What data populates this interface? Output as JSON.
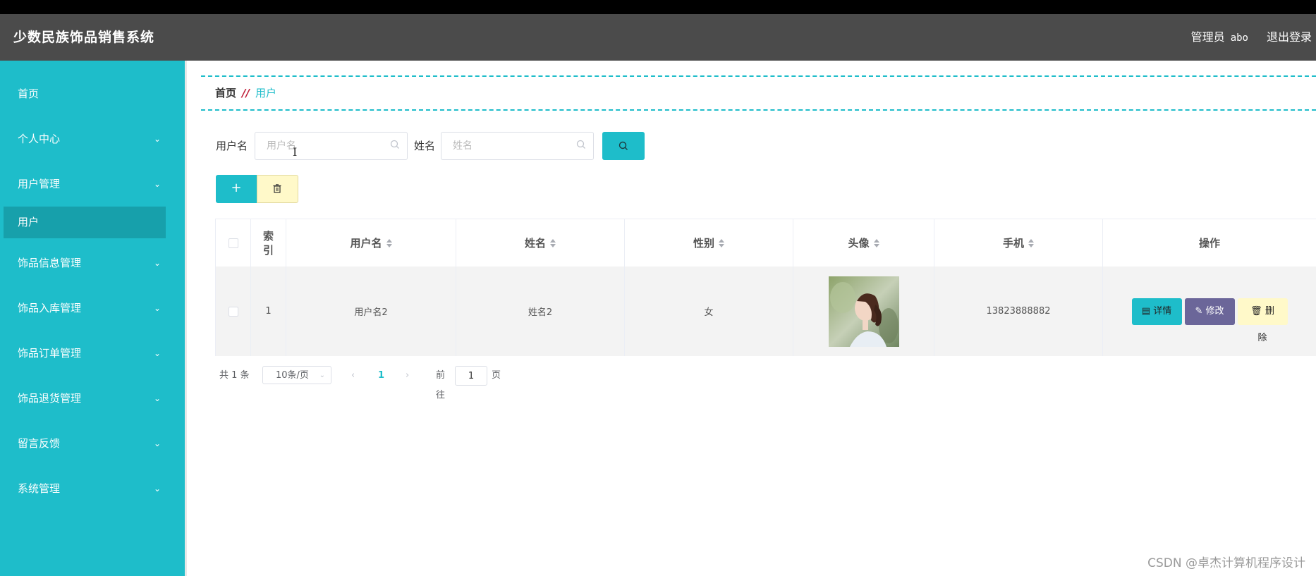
{
  "app": {
    "title": "少数民族饰品销售系统"
  },
  "header": {
    "role": "管理员",
    "username": "abo",
    "logout": "退出登录"
  },
  "sidebar": {
    "items": [
      {
        "label": "首页",
        "has_children": false
      },
      {
        "label": "个人中心",
        "has_children": true
      },
      {
        "label": "用户管理",
        "has_children": true
      },
      {
        "label": "饰品信息管理",
        "has_children": true
      },
      {
        "label": "饰品入库管理",
        "has_children": true
      },
      {
        "label": "饰品订单管理",
        "has_children": true
      },
      {
        "label": "饰品退货管理",
        "has_children": true
      },
      {
        "label": "留言反馈",
        "has_children": true
      },
      {
        "label": "系统管理",
        "has_children": true
      }
    ],
    "active_sub": "用户"
  },
  "breadcrumb": {
    "home": "首页",
    "separator": "//",
    "current": "用户"
  },
  "search": {
    "username_label": "用户名",
    "username_placeholder": "用户名",
    "username_value": "",
    "name_label": "姓名",
    "name_placeholder": "姓名",
    "name_value": ""
  },
  "actions": {
    "add": "+",
    "delete_icon": "trash-icon"
  },
  "table": {
    "headers": {
      "index": "索引",
      "username": "用户名",
      "name": "姓名",
      "gender": "性别",
      "avatar": "头像",
      "phone": "手机",
      "ops": "操作"
    },
    "rows": [
      {
        "index": "1",
        "username": "用户名2",
        "name": "姓名2",
        "gender": "女",
        "phone": "13823888882"
      }
    ],
    "row_buttons": {
      "detail": "详情",
      "edit": "修改",
      "delete": "删除"
    }
  },
  "pagination": {
    "total_prefix": "共",
    "total": "1",
    "total_suffix": "条",
    "page_size": "10条/页",
    "current_page": "1",
    "goto_label": "前往",
    "goto_value": "1",
    "goto_suffix": "页"
  },
  "watermark": "CSDN @卓杰计算机程序设计",
  "colors": {
    "accent": "#1ebdca",
    "header": "#4b4b4b",
    "edit": "#6b6699",
    "delete": "#fff9c9"
  }
}
